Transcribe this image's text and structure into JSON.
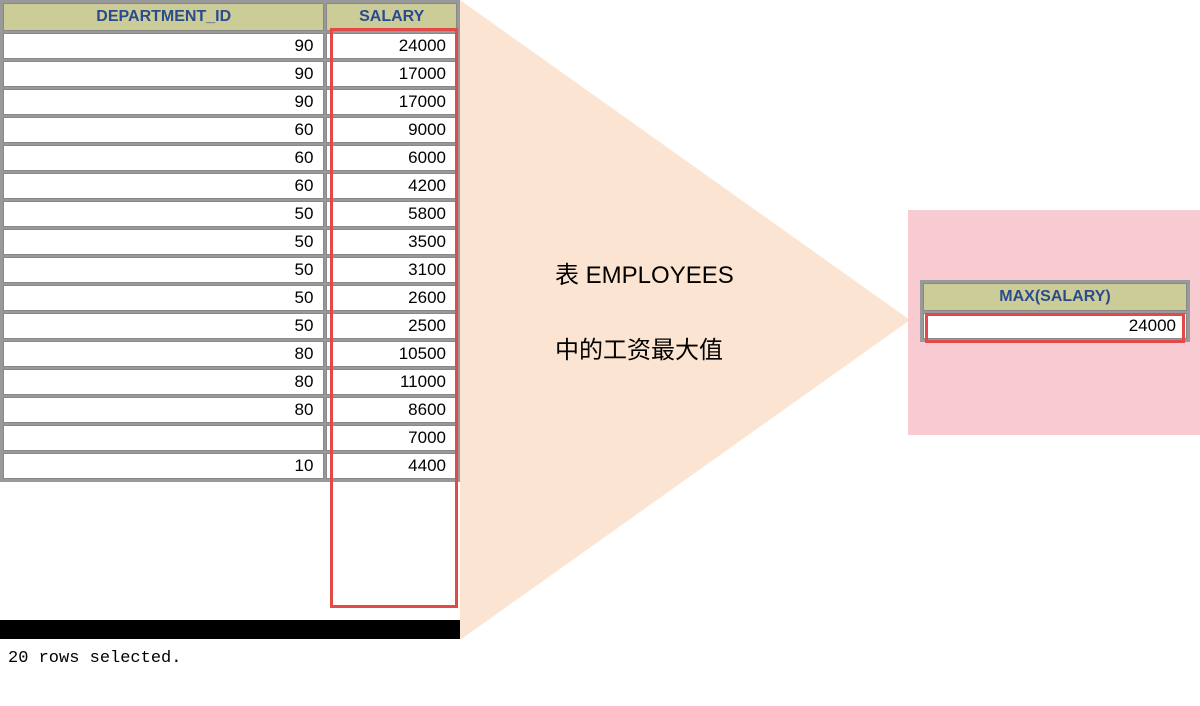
{
  "left_table": {
    "headers": {
      "dept": "DEPARTMENT_ID",
      "salary": "SALARY"
    },
    "rows": [
      {
        "dept": "90",
        "salary": "24000"
      },
      {
        "dept": "90",
        "salary": "17000"
      },
      {
        "dept": "90",
        "salary": "17000"
      },
      {
        "dept": "60",
        "salary": "9000"
      },
      {
        "dept": "60",
        "salary": "6000"
      },
      {
        "dept": "60",
        "salary": "4200"
      },
      {
        "dept": "50",
        "salary": "5800"
      },
      {
        "dept": "50",
        "salary": "3500"
      },
      {
        "dept": "50",
        "salary": "3100"
      },
      {
        "dept": "50",
        "salary": "2600"
      },
      {
        "dept": "50",
        "salary": "2500"
      },
      {
        "dept": "80",
        "salary": "10500"
      },
      {
        "dept": "80",
        "salary": "11000"
      },
      {
        "dept": "80",
        "salary": "8600"
      },
      {
        "dept": "",
        "salary": "7000"
      },
      {
        "dept": "10",
        "salary": "4400"
      }
    ]
  },
  "status_text": "20 rows selected.",
  "annotation": {
    "line1": "表 EMPLOYEES",
    "line2": "中的工资最大值"
  },
  "result_table": {
    "header": "MAX(SALARY)",
    "value": "24000"
  }
}
